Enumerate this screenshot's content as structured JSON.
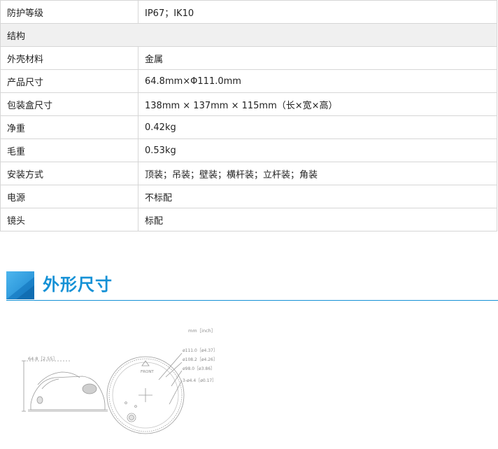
{
  "spec_rows": [
    {
      "type": "row",
      "label": "防护等级",
      "value": "IP67；IK10"
    },
    {
      "type": "section",
      "label": "结构"
    },
    {
      "type": "row",
      "label": "外壳材料",
      "value": "金属"
    },
    {
      "type": "row",
      "label": "产品尺寸",
      "value": "64.8mm×Φ111.0mm"
    },
    {
      "type": "row",
      "label": "包装盒尺寸",
      "value": "138mm × 137mm × 115mm（长×宽×高）"
    },
    {
      "type": "row",
      "label": "净重",
      "value": "0.42kg"
    },
    {
      "type": "row",
      "label": "毛重",
      "value": "0.53kg"
    },
    {
      "type": "row",
      "label": "安装方式",
      "value": "顶装；吊装；壁装；横杆装；立杆装；角装"
    },
    {
      "type": "row",
      "label": "电源",
      "value": "不标配"
    },
    {
      "type": "row",
      "label": "镜头",
      "value": "标配"
    }
  ],
  "dimensions_section": {
    "title": "外形尺寸",
    "accent_color": "#1591d6"
  },
  "drawing": {
    "unit_note": "mm［inch］",
    "height_label": "64.8［2.55］",
    "front_label": "FRONT",
    "diameter_labels": [
      "ø111.0［ø4.37］",
      "ø108.2［ø4.26］",
      "ø98.0［ø3.86］",
      "3-ø4.4［ø0.17］"
    ]
  }
}
